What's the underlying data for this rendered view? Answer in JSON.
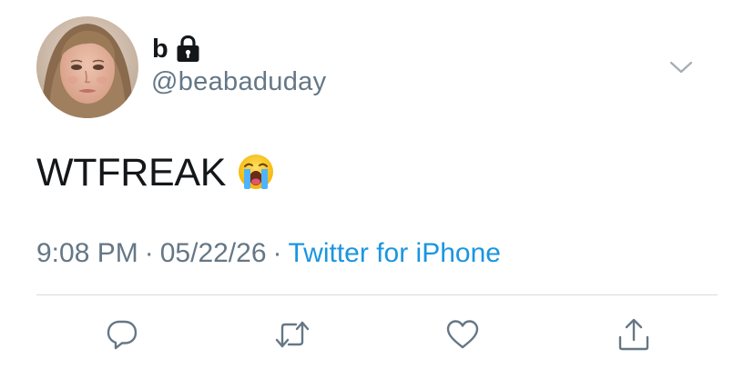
{
  "user": {
    "display_name": "b",
    "handle": "@beabaduday",
    "protected": true,
    "avatar_icon": "avatar"
  },
  "tweet": {
    "text": "WTFREAK",
    "emoji_icon": "loudly-crying-face-emoji"
  },
  "meta": {
    "time": "9:08 PM",
    "separator": "·",
    "date": "05/22/26",
    "source": "Twitter for iPhone"
  },
  "actions": {
    "reply_icon": "reply-icon",
    "retweet_icon": "retweet-icon",
    "like_icon": "heart-icon",
    "share_icon": "share-icon",
    "menu_icon": "chevron-down-icon"
  },
  "colors": {
    "text": "#14171a",
    "secondary": "#657786",
    "link": "#1b95e0",
    "divider": "#d6dbdf",
    "icon": "#657786"
  }
}
